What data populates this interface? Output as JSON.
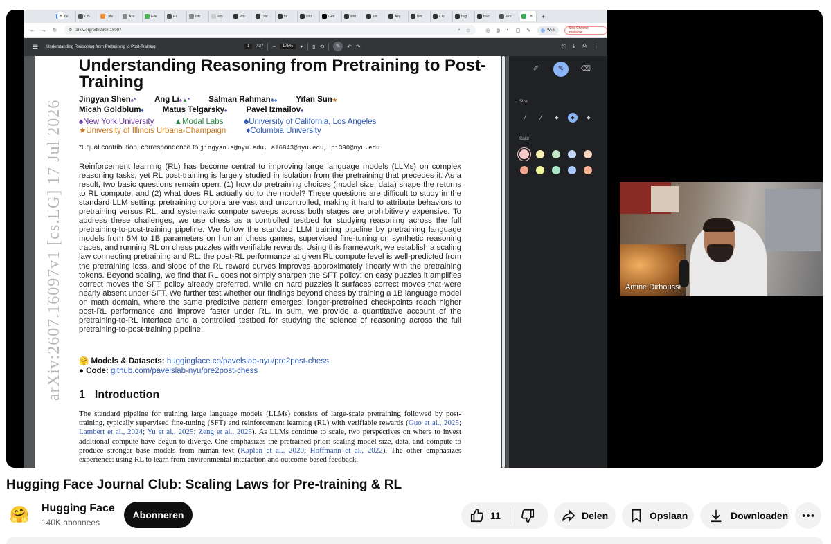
{
  "browser": {
    "tabs": [
      {
        "label": "Trai",
        "color": "#4285f4"
      },
      {
        "label": "On-",
        "color": "#555555"
      },
      {
        "label": "Dee",
        "color": "#f28b30"
      },
      {
        "label": "Ass",
        "color": "#888888"
      },
      {
        "label": "Eve",
        "color": "#4caf50"
      },
      {
        "label": "RL",
        "color": "#555555"
      },
      {
        "label": "Intr",
        "color": "#888888"
      },
      {
        "label": "asy",
        "color": "#cccccc"
      },
      {
        "label": "Pro",
        "color": "#333333"
      },
      {
        "label": "Dist",
        "color": "#333333"
      },
      {
        "label": "fix",
        "color": "#333333"
      },
      {
        "label": "sori",
        "color": "#333333"
      },
      {
        "label": "Gen",
        "color": "#000000"
      },
      {
        "label": "sori",
        "color": "#333333"
      },
      {
        "label": "ker",
        "color": "#333333"
      },
      {
        "label": "Asy",
        "color": "#333333"
      },
      {
        "label": "Not",
        "color": "#333333"
      },
      {
        "label": "Clo",
        "color": "#333333"
      },
      {
        "label": "hug",
        "color": "#333333"
      },
      {
        "label": "tran",
        "color": "#333333"
      },
      {
        "label": "Mor",
        "color": "#555555"
      }
    ],
    "url": "arxiv.org/pdf/2607.16097",
    "profile_label": "Work",
    "update_label": "New Chrome available"
  },
  "pdf_viewer": {
    "title": "Understanding Reasoning from Pretraining to Post-Training",
    "page_current": "1",
    "page_total": "/ 37",
    "zoom": "175%"
  },
  "annotation_panel": {
    "size_label": "Size",
    "color_label": "Color",
    "colors": [
      "#f6c9c9",
      "#f7f0b5",
      "#bfe6c5",
      "#c6d8f8",
      "#f8d6bf",
      "#f0a48c",
      "#eef59a",
      "#a7e7c7",
      "#a9c7fa",
      "#f4b08f"
    ]
  },
  "paper": {
    "arxiv_stamp": "arXiv:2607.16097v1 [cs.LG] 17 Jul 2026",
    "title": "Understanding Reasoning from Pretraining to Post-Training",
    "authors": {
      "a1": "Jingyan Shen",
      "a2": "Ang Li",
      "a3": "Salman Rahman",
      "a4": "Yifan Sun",
      "a5": "Micah Goldblum",
      "a6": "Matus Telgarsky",
      "a7": "Pavel Izmailov"
    },
    "affiliations": {
      "nyu": "New York University",
      "modal": "Modal Labs",
      "ucla": "University of California, Los Angeles",
      "uiuc": "University of Illinois Urbana-Champaign",
      "columbia": "Columbia University"
    },
    "equal_contribution": "*Equal contribution, correspondence to",
    "emails": "jingyan.s@nyu.edu, al6843@nyu.edu, pi390@nyu.edu",
    "abstract": "Reinforcement learning (RL) has become central to improving large language models (LLMs) on complex reasoning tasks, yet RL post-training is largely studied in isolation from the pretraining that precedes it. As a result, two basic questions remain open: (1) how do pretraining choices (model size, data) shape the returns to RL compute, and (2) what does RL actually do to the model? These questions are difficult to study in the standard LLM setting: pretraining corpora are vast and uncontrolled, making it hard to attribute behaviors to pretraining versus RL, and systematic compute sweeps across both stages are prohibitively expensive. To address these challenges, we use chess as a controlled testbed for studying reasoning across the full pretraining-to-post-training pipeline. We follow the standard LLM training pipeline by pretraining language models from 5M to 1B parameters on human chess games, supervised fine-tuning on synthetic reasoning traces, and running RL on chess puzzles with verifiable rewards. Using this framework, we establish a scaling law connecting pretraining and RL: the post-RL performance at given RL compute level is well-predicted from the pretraining loss, and slope of the RL reward curves improves approximately linearly with the pretraining tokens. Beyond scaling, we find that RL does not simply sharpen the SFT policy: on easy puzzles it amplifies correct moves the SFT policy already preferred, while on hard puzzles it surfaces correct moves that were nearly absent under SFT. We further test whether our findings beyond chess by training a 1B language model on math domain, where the same predictive pattern emerges: longer-pretrained checkpoints reach higher post-RL performance and improve faster under RL. In sum, we provide a quantitative account of the pretraining-to-RL interface and a controlled testbed for studying the science of reasoning across the full pretraining-to-post-training pipeline.",
    "models_label": "Models & Datasets",
    "models_url": "huggingface.co/pavelslab-nyu/pre2post-chess",
    "code_label": "Code",
    "code_url": "github.com/pavelslab-nyu/pre2post-chess",
    "section_num": "1",
    "section_title": "Introduction",
    "intro": {
      "t1": "The standard pipeline for training large language models (LLMs) consists of large-scale pretraining followed by post-training, typically supervised fine-tuning (SFT) and reinforcement learning (RL) with verifiable rewards (",
      "c1": "Guo et al., 2025",
      "s1": "; ",
      "c2": "Lambert et al., 2024",
      "s2": "; ",
      "c3": "Yu et al., 2025",
      "s3": "; ",
      "c4": "Zeng et al., 2025",
      "t2": "). As LLMs continue to scale, two perspectives on where to invest additional compute have begun to diverge. One emphasizes the pretrained prior: scaling model size, data, and compute to produce stronger base models from human text (",
      "c5": "Kaplan et al., 2020",
      "s5": "; ",
      "c6": "Hoffmann et al., 2022",
      "t3": "). The other emphasizes experience: using RL to learn from environmental interaction and outcome-based feedback,"
    }
  },
  "webcam": {
    "name": "Amine Dirhoussi"
  },
  "video": {
    "title": "Hugging Face Journal Club: Scaling Laws for Pre-training & RL",
    "channel": "Hugging Face",
    "subscribers": "140K abonnees",
    "subscribe_label": "Abonneren",
    "likes": "11",
    "share_label": "Delen",
    "save_label": "Opslaan",
    "download_label": "Downloaden"
  }
}
